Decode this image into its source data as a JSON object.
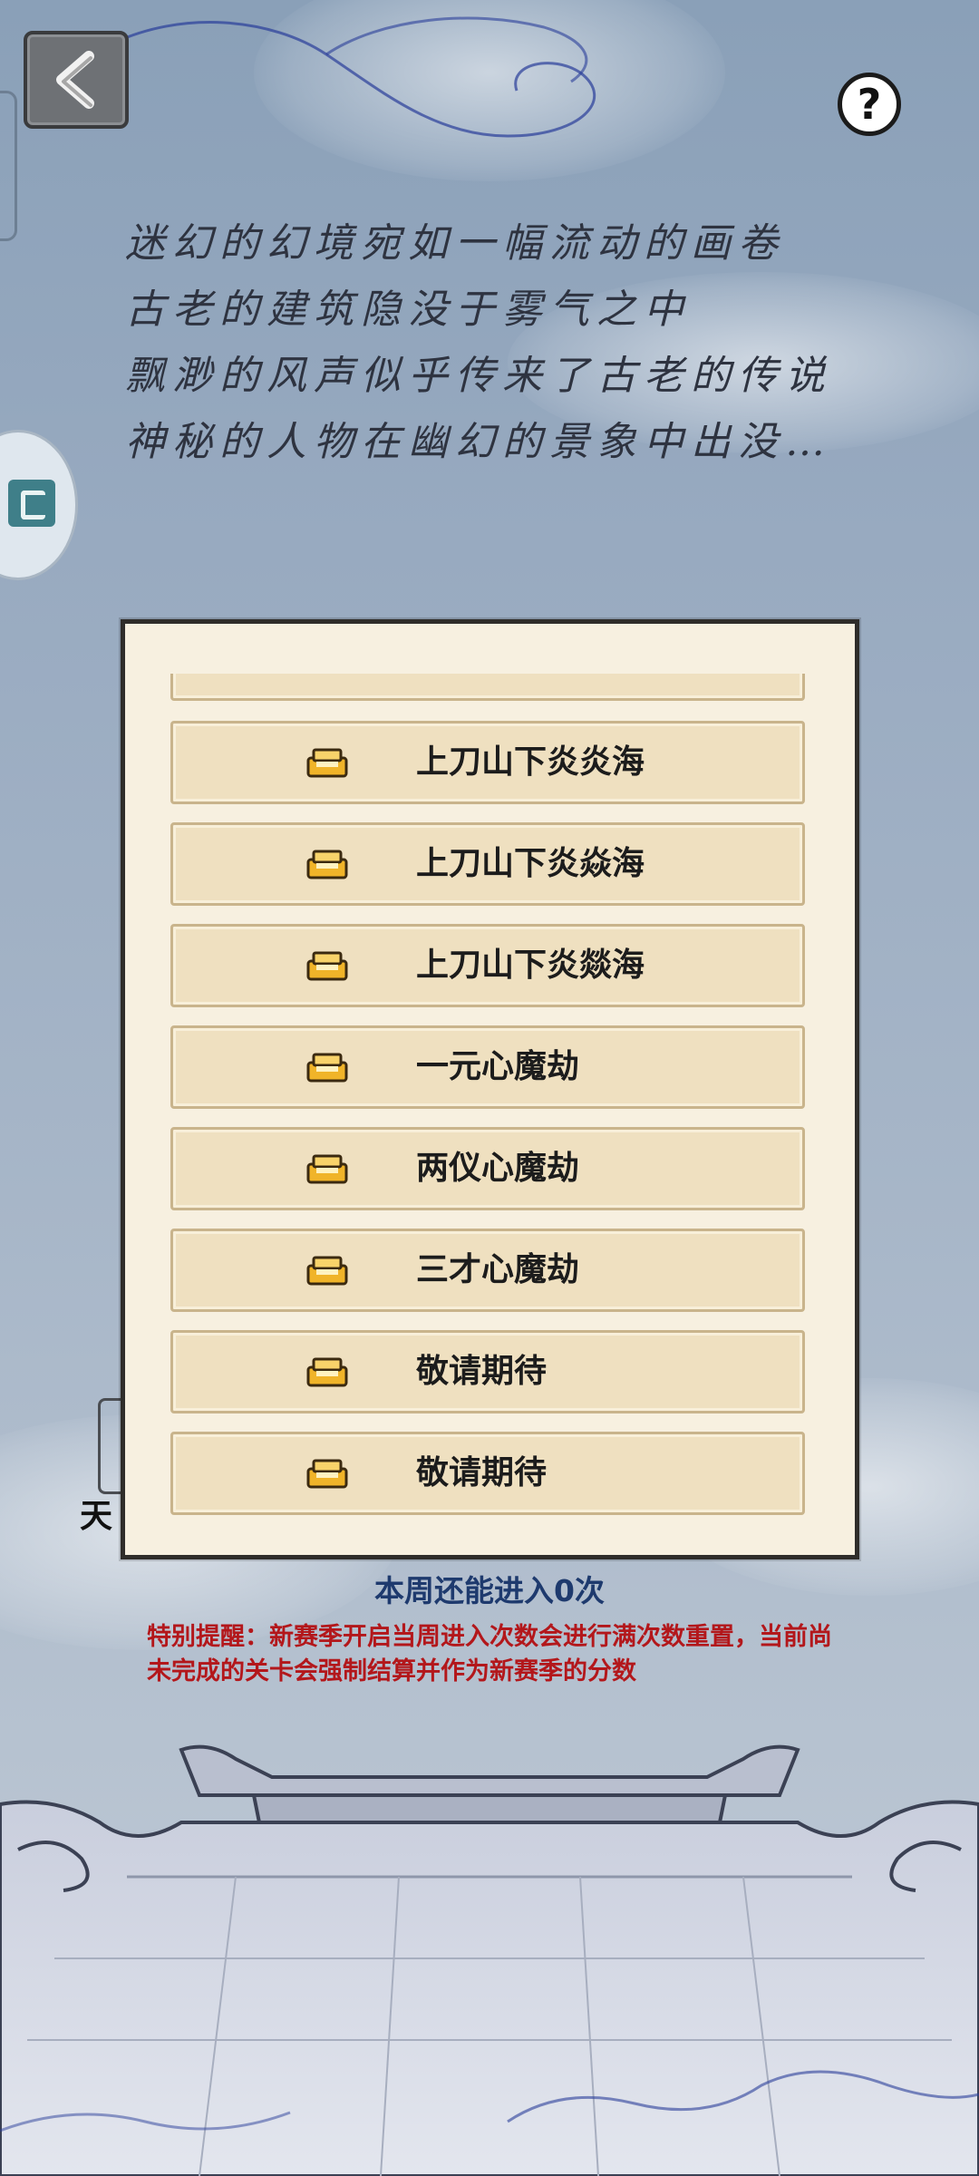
{
  "header": {
    "back_icon": "chevron-left-icon",
    "help_icon": "question-mark-icon",
    "help_glyph": "?"
  },
  "poem": {
    "lines": [
      "迷幻的幻境宛如一幅流动的画卷",
      "古老的建筑隐没于雾气之中",
      "飘渺的风声似乎传来了古老的传说",
      "神秘的人物在幽幻的景象中出没…"
    ]
  },
  "side": {
    "partial_label": "天"
  },
  "level_list": {
    "chest_icon": "gold-chest-icon",
    "items": [
      {
        "label": "上刀山下炎炎海"
      },
      {
        "label": "上刀山下炎焱海"
      },
      {
        "label": "上刀山下炎燚海"
      },
      {
        "label": "一元心魔劫"
      },
      {
        "label": "两仪心魔劫"
      },
      {
        "label": "三才心魔劫"
      },
      {
        "label": "敬请期待"
      },
      {
        "label": "敬请期待"
      }
    ]
  },
  "status": {
    "weekly_entries": "本周还能进入0次",
    "notice": "特别提醒：新赛季开启当周进入次数会进行满次数重置，当前尚未完成的关卡会强制结算并作为新赛季的分数"
  },
  "colors": {
    "notice": "#b3171b",
    "counter": "#1e3a6e",
    "panel_bg": "#f7f0e0",
    "item_bg": "#efe0c0",
    "chest_gold": "#f0b429"
  }
}
